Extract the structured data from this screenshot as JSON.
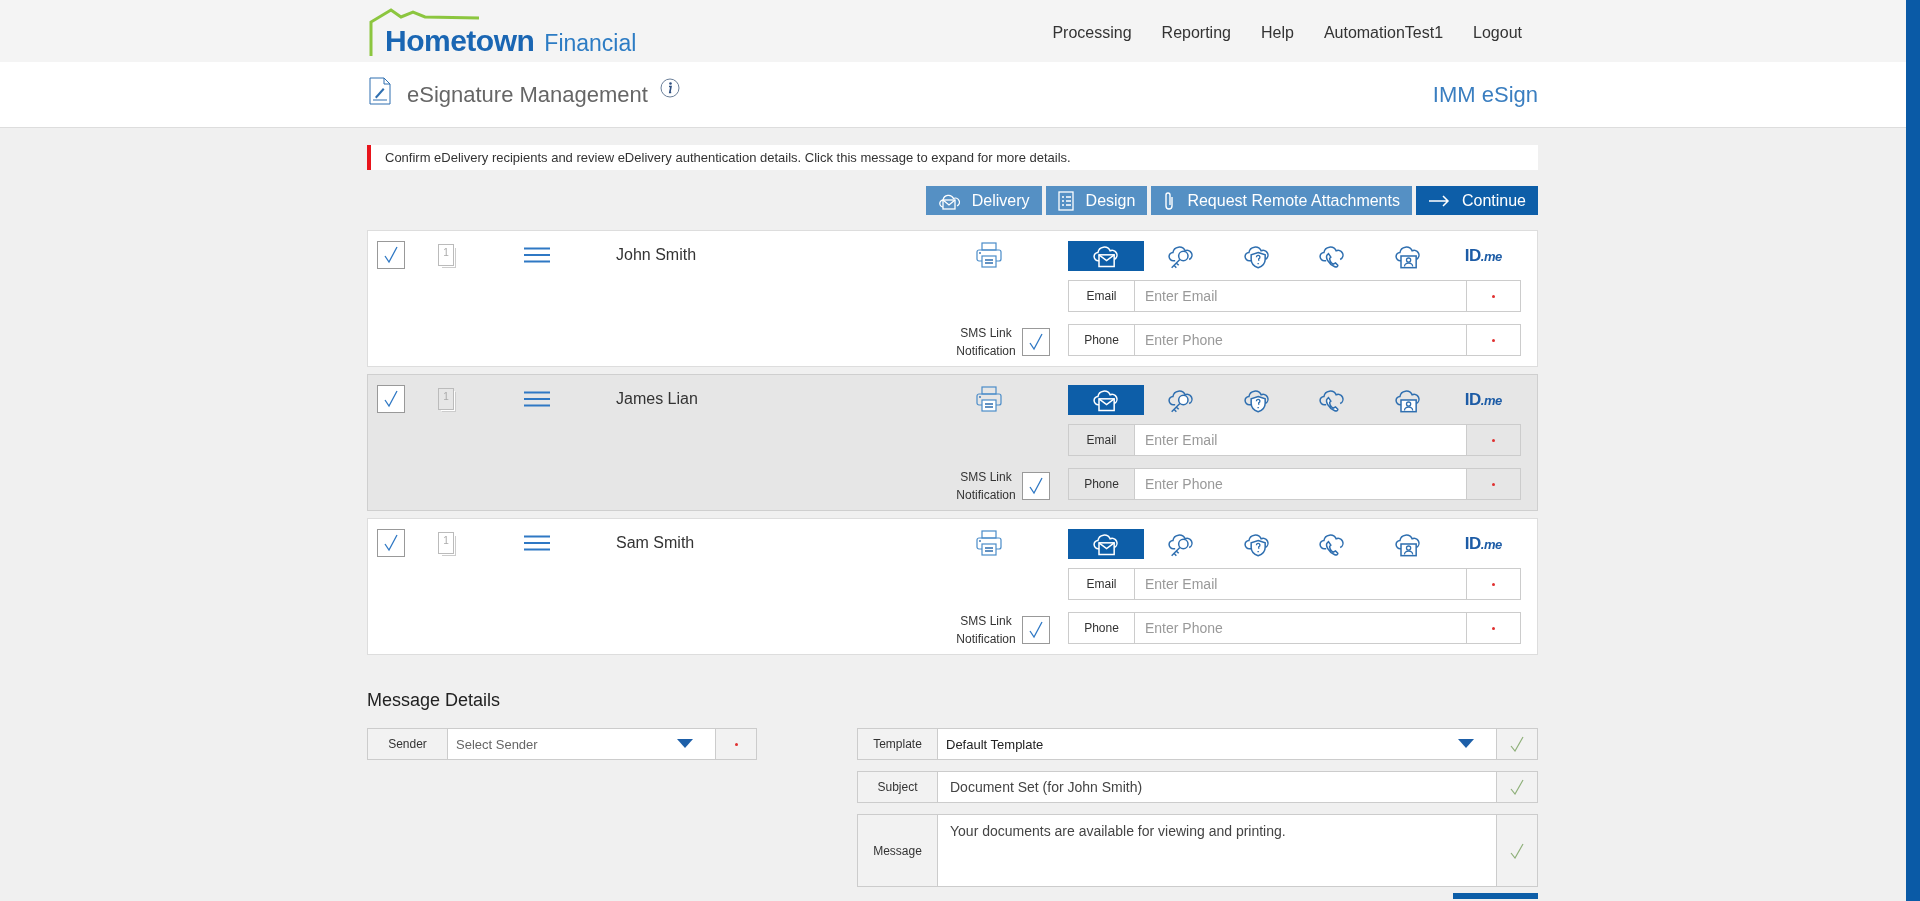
{
  "header": {
    "logo": {
      "brand": "Hometown",
      "suffix": "Financial"
    },
    "nav": [
      "Processing",
      "Reporting",
      "Help",
      "AutomationTest1",
      "Logout"
    ]
  },
  "title_bar": {
    "title": "eSignature Management",
    "product": "IMM eSign"
  },
  "notice": "Confirm eDelivery recipients and review eDelivery authentication details. Click this message to expand for more details.",
  "actions": [
    {
      "label": "Delivery",
      "kind": "delivery"
    },
    {
      "label": "Design",
      "kind": "design"
    },
    {
      "label": "Request Remote Attachments",
      "kind": "attach"
    },
    {
      "label": "Continue",
      "kind": "continue"
    }
  ],
  "recipients": [
    {
      "name": "John Smith",
      "included": true,
      "shaded": false,
      "page_count": "1",
      "sms_label": "SMS Link Notification",
      "sms": true,
      "methods": [
        {
          "kind": "email",
          "selected": true
        },
        {
          "kind": "key",
          "selected": false
        },
        {
          "kind": "question",
          "selected": false
        },
        {
          "kind": "phone",
          "selected": false
        },
        {
          "kind": "person",
          "selected": false
        },
        {
          "kind": "idme",
          "label": "ID",
          "label_italic": ".me",
          "selected": false
        }
      ],
      "fields": [
        {
          "label": "Email",
          "placeholder": "Enter Email",
          "required": true
        },
        {
          "label": "Phone",
          "placeholder": "Enter Phone",
          "required": true
        }
      ]
    },
    {
      "name": "James Lian",
      "included": true,
      "shaded": true,
      "page_count": "1",
      "sms_label": "SMS Link Notification",
      "sms": true,
      "methods": [
        {
          "kind": "email",
          "selected": true
        },
        {
          "kind": "key",
          "selected": false
        },
        {
          "kind": "question",
          "selected": false
        },
        {
          "kind": "phone",
          "selected": false
        },
        {
          "kind": "person",
          "selected": false
        },
        {
          "kind": "idme",
          "label": "ID",
          "label_italic": ".me",
          "selected": false
        }
      ],
      "fields": [
        {
          "label": "Email",
          "placeholder": "Enter Email",
          "required": true
        },
        {
          "label": "Phone",
          "placeholder": "Enter Phone",
          "required": true
        }
      ]
    },
    {
      "name": "Sam Smith",
      "included": true,
      "shaded": false,
      "page_count": "1",
      "sms_label": "SMS Link Notification",
      "sms": true,
      "methods": [
        {
          "kind": "email",
          "selected": true
        },
        {
          "kind": "key",
          "selected": false
        },
        {
          "kind": "question",
          "selected": false
        },
        {
          "kind": "phone",
          "selected": false
        },
        {
          "kind": "person",
          "selected": false
        },
        {
          "kind": "idme",
          "label": "ID",
          "label_italic": ".me",
          "selected": false
        }
      ],
      "fields": [
        {
          "label": "Email",
          "placeholder": "Enter Email",
          "required": true
        },
        {
          "label": "Phone",
          "placeholder": "Enter Phone",
          "required": true
        }
      ]
    }
  ],
  "message_details": {
    "heading": "Message Details",
    "sender": {
      "label": "Sender",
      "placeholder": "Select Sender",
      "required": true
    },
    "template": {
      "label": "Template",
      "value": "Default Template",
      "valid": true
    },
    "subject": {
      "label": "Subject",
      "value": "Document Set (for John Smith)",
      "valid": true
    },
    "message": {
      "label": "Message",
      "value": "Your documents are available for viewing and printing.",
      "valid": true
    }
  }
}
